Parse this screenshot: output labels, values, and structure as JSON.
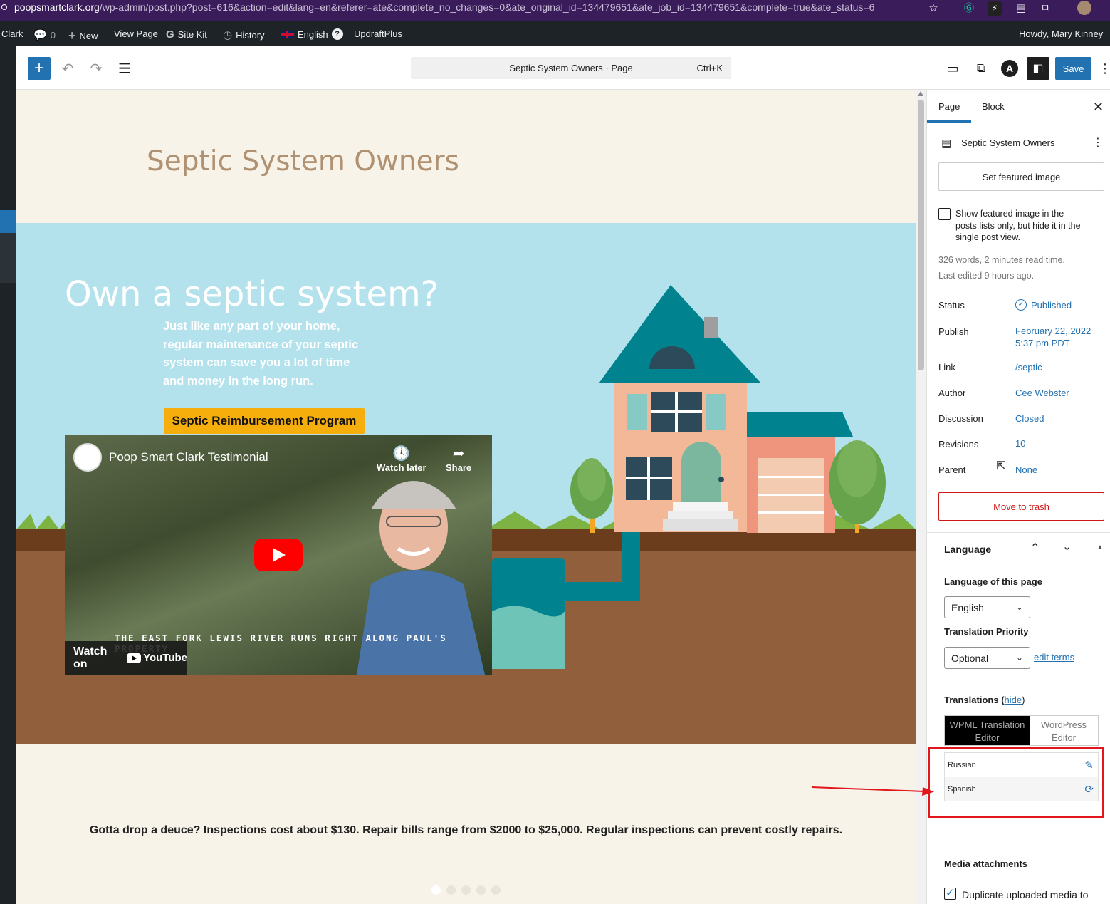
{
  "browser": {
    "url_domain": "poopsmartclark.org",
    "url_path": "/wp-admin/post.php?post=616&action=edit&lang=en&referer=ate&complete_no_changes=0&ate_original_id=134479651&ate_job_id=134479651&complete=true&ate_status=6",
    "icons": [
      "star-icon",
      "grammarly-icon",
      "extension-icon",
      "extension-icon",
      "puzzle-icon",
      "profile-avatar"
    ]
  },
  "adminbar": {
    "site": "Clark",
    "comments_count": "0",
    "new_label": "New",
    "view_page": "View Page",
    "site_kit": "Site Kit",
    "history": "History",
    "language": "English",
    "help_glyph": "?",
    "updraft": "UpdraftPlus",
    "howdy": "Howdy, Mary Kinney"
  },
  "toolbar": {
    "command_title": "Septic System Owners · Page",
    "command_shortcut": "Ctrl+K",
    "save_label": "Save"
  },
  "canvas": {
    "page_title": "Septic System Owners",
    "hero_heading": "Own a septic system?",
    "hero_text": "Just like any part of your home, regular maintenance of your septic system can save you a lot of time and money in the long run.",
    "hero_button": "Septic Reimbursement Program",
    "video": {
      "title": "Poop Smart Clark Testimonial",
      "watch_later": "Watch later",
      "share": "Share",
      "caption": "THE EAST FORK LEWIS RIVER RUNS RIGHT ALONG PAUL'S PROPERTY",
      "watch_on": "Watch on",
      "youtube": "YouTube"
    },
    "bottom_text": "Gotta drop a deuce? Inspections cost about $130. Repair bills range from $2000 to $25,000. Regular inspections can prevent costly repairs.",
    "carousel_dots": 5
  },
  "sidebar": {
    "tab_page": "Page",
    "tab_block": "Block",
    "doc_title": "Septic System Owners",
    "featured_image_button": "Set featured image",
    "featured_checkbox_label": "Show featured image in the posts lists only, but hide it in the single post view.",
    "word_count": "326 words, 2 minutes read time.",
    "last_edited": "Last edited 9 hours ago.",
    "rows": [
      {
        "label": "Status",
        "value": "Published"
      },
      {
        "label": "Publish",
        "value": "February 22, 2022",
        "value2": "5:37 pm PDT"
      },
      {
        "label": "Link",
        "value": "/septic"
      },
      {
        "label": "Author",
        "value": "Cee Webster"
      },
      {
        "label": "Discussion",
        "value": "Closed"
      },
      {
        "label": "Revisions",
        "value": "10"
      },
      {
        "label": "Parent",
        "value": "None"
      }
    ],
    "trash_button": "Move to trash",
    "language_panel": {
      "title": "Language",
      "lang_of_page_label": "Language of this page",
      "lang_value": "English",
      "priority_label": "Translation Priority",
      "priority_value": "Optional",
      "edit_terms": "edit terms",
      "translations_label": "Translations (",
      "hide_link": "hide",
      "translations_close": ")",
      "editor_tab_a": "WPML Translation Editor",
      "editor_tab_b": "WordPress Editor",
      "translations": [
        {
          "lang": "Russian",
          "icon": "pencil-icon"
        },
        {
          "lang": "Spanish",
          "icon": "refresh-icon"
        }
      ]
    },
    "media_title": "Media attachments",
    "media_checkbox": "Duplicate uploaded media to"
  },
  "colors": {
    "accent": "#2271b1",
    "annotation": "#e2161d",
    "hero_bg": "#b3e2ec",
    "soil": "#925f3d",
    "button": "#f5ae0b"
  }
}
